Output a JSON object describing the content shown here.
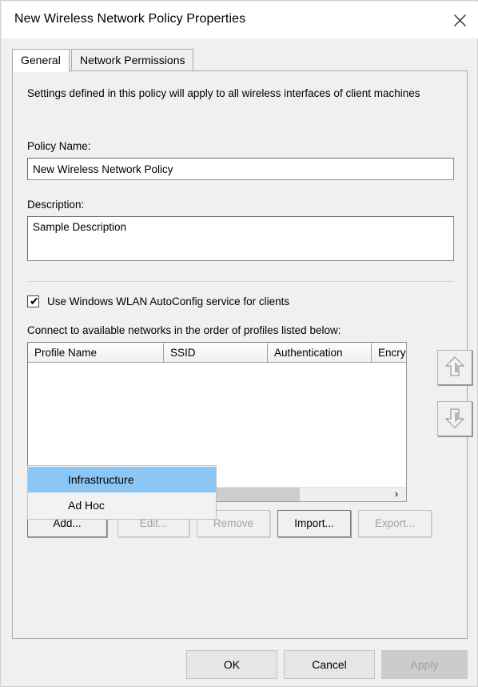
{
  "window": {
    "title": "New Wireless Network Policy Properties",
    "close_icon": "close-icon"
  },
  "tabs": [
    {
      "label": "General",
      "active": true
    },
    {
      "label": "Network Permissions",
      "active": false
    }
  ],
  "general": {
    "intro_text": "Settings defined in this policy will apply to all wireless interfaces of client machines",
    "policy_name_label": "Policy Name:",
    "policy_name_value": "New Wireless Network Policy",
    "policy_name_placeholder": "",
    "description_label": "Description:",
    "description_value": "Sample Description",
    "description_placeholder": "",
    "autoconfig_checkbox": {
      "label": "Use Windows WLAN AutoConfig service for clients",
      "checked": true,
      "tick": "✔"
    },
    "profiles_label": "Connect to available networks in the order of profiles listed below:",
    "profiles_table": {
      "columns": [
        "Profile Name",
        "SSID",
        "Authentication",
        "Encry"
      ],
      "rows": []
    },
    "scrollbar": {
      "right_arrow": "›"
    },
    "move_buttons": [
      {
        "name": "move-up-icon",
        "enabled": false
      },
      {
        "name": "move-down-icon",
        "enabled": false
      }
    ],
    "action_buttons": [
      {
        "label": "Add...",
        "enabled": true
      },
      {
        "label": "Edit...",
        "enabled": false
      },
      {
        "label": "Remove",
        "enabled": false
      },
      {
        "label": "Import...",
        "enabled": true
      },
      {
        "label": "Export...",
        "enabled": false
      }
    ],
    "dropdown": {
      "items": [
        {
          "label": "Infrastructure",
          "selected": true
        },
        {
          "label": "Ad Hoc",
          "selected": false
        }
      ],
      "highlight_color": "#8cc6f5"
    }
  },
  "footer": {
    "ok_label": "OK",
    "cancel_label": "Cancel",
    "apply_label": "Apply",
    "apply_enabled": false
  }
}
